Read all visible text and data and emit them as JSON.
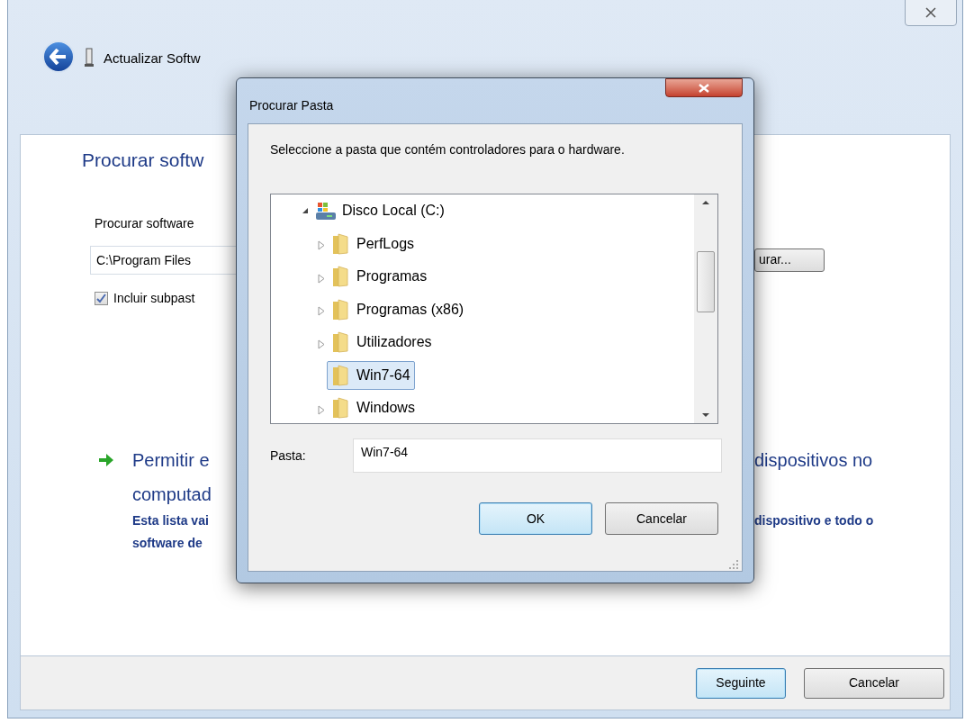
{
  "window": {
    "title": "Actualizar Softw"
  },
  "main": {
    "heading": "Procurar softw",
    "label": "Procurar software",
    "path_value": "C:\\Program Files",
    "checkbox": {
      "label": "Incluir subpast",
      "checked": true
    },
    "browse_button": "urar...",
    "option": {
      "title_left": "Permitir e",
      "title_right": "dispositivos no",
      "title_line2": "computad",
      "desc_left": "Esta lista vai",
      "desc_right": "dispositivo e todo o",
      "desc_line2": "software de"
    }
  },
  "footer_buttons": [
    {
      "label": "Seguinte",
      "default": true
    },
    {
      "label": "Cancelar",
      "default": false
    }
  ],
  "dialog": {
    "title": "Procurar Pasta",
    "instruction": "Seleccione a pasta que contém controladores para o hardware.",
    "tree": [
      {
        "label": "Disco Local (C:)",
        "kind": "drive",
        "expanded": true,
        "selected": false,
        "children": [
          {
            "label": "PerfLogs",
            "kind": "folder",
            "expanded": false,
            "selected": false
          },
          {
            "label": "Programas",
            "kind": "folder",
            "expanded": false,
            "selected": false
          },
          {
            "label": "Programas (x86)",
            "kind": "folder",
            "expanded": false,
            "selected": false
          },
          {
            "label": "Utilizadores",
            "kind": "folder",
            "expanded": false,
            "selected": false
          },
          {
            "label": "Win7-64",
            "kind": "folder",
            "selected": true
          },
          {
            "label": "Windows",
            "kind": "folder",
            "expanded": false,
            "selected": false
          }
        ]
      }
    ],
    "folder_label": "Pasta:",
    "folder_value": "Win7-64",
    "buttons": [
      {
        "label": "OK",
        "default": true
      },
      {
        "label": "Cancelar",
        "default": false
      }
    ]
  }
}
